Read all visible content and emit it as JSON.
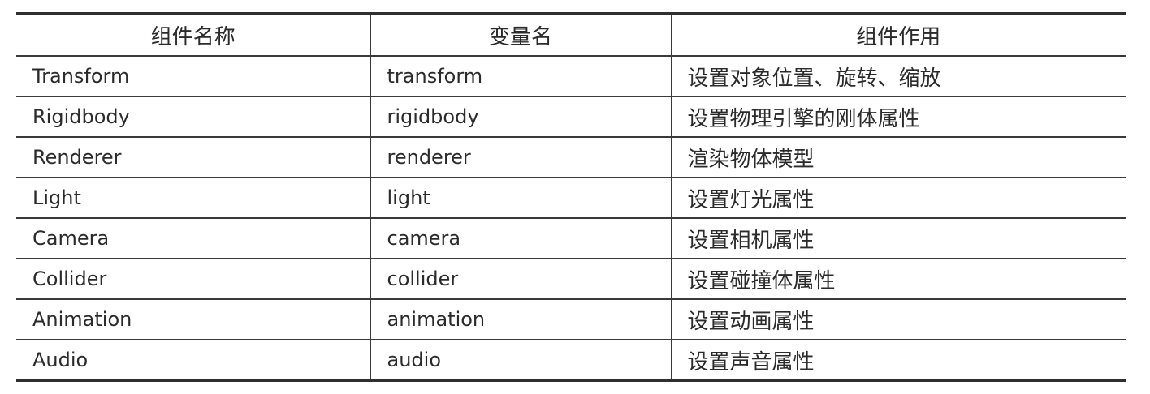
{
  "table": {
    "headers": [
      "组件名称",
      "变量名",
      "组件作用"
    ],
    "rows": [
      {
        "component": "Transform",
        "variable": "transform",
        "purpose": "设置对象位置、旋转、缩放"
      },
      {
        "component": "Rigidbody",
        "variable": "rigidbody",
        "purpose": "设置物理引擎的刚体属性"
      },
      {
        "component": "Renderer",
        "variable": "renderer",
        "purpose": "渲染物体模型"
      },
      {
        "component": "Light",
        "variable": "light",
        "purpose": "设置灯光属性"
      },
      {
        "component": "Camera",
        "variable": "camera",
        "purpose": "设置相机属性"
      },
      {
        "component": "Collider",
        "variable": "collider",
        "purpose": "设置碰撞体属性"
      },
      {
        "component": "Animation",
        "variable": "animation",
        "purpose": "设置动画属性"
      },
      {
        "component": "Audio",
        "variable": "audio",
        "purpose": "设置声音属性"
      }
    ]
  }
}
